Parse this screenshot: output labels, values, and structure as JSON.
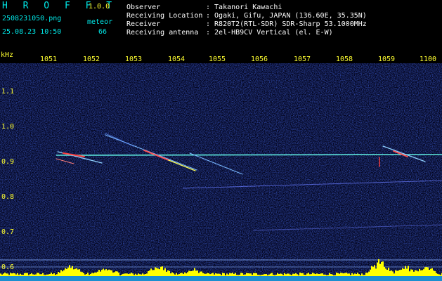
{
  "header": {
    "app_name": "H R O F F T",
    "version": "1.0.0",
    "file_name": "2508231050.png",
    "timestamp": "25.08.23 10:50",
    "meteor_label": "meteor",
    "meteor_count": "66",
    "fields": [
      {
        "label": "Observer",
        "value": ": Takanori Kawachi"
      },
      {
        "label": "Receiving Location",
        "value": ": Ogaki, Gifu, JAPAN (136.60E, 35.35N)"
      },
      {
        "label": "Receiver",
        "value": ": R820T2(RTL-SDR) SDR-Sharp 53.1000MHz"
      },
      {
        "label": "Receiving antenna",
        "value": ": 2el-HB9CV Vertical (el. E-W)"
      }
    ]
  },
  "axis": {
    "unit": "kHz",
    "time_ticks": [
      "1051",
      "1052",
      "1053",
      "1054",
      "1055",
      "1056",
      "1057",
      "1058",
      "1059",
      "1100"
    ],
    "freq_ticks": [
      "1.1",
      "1.0",
      "0.9",
      "0.8",
      "0.7",
      "0.6"
    ]
  },
  "colors": {
    "background": "#000000",
    "noise": "#1a2a9a",
    "carrier": "#66ffee",
    "histogram": "#ffff00",
    "label": "#ffff30"
  }
}
